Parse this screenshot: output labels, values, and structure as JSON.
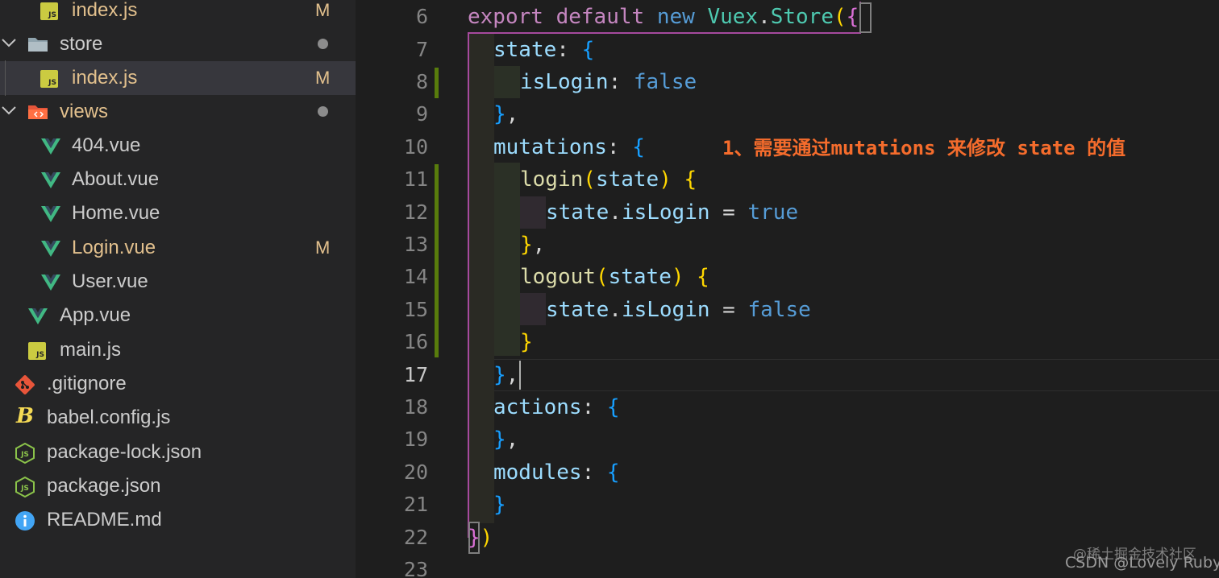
{
  "explorer": {
    "items": [
      {
        "label": "index.js",
        "icon": "js-file-icon",
        "status": "M",
        "modified": true
      },
      {
        "label": "store",
        "icon": "folder-icon",
        "status_dot": true
      },
      {
        "label": "index.js",
        "icon": "js-file-icon",
        "status": "M",
        "modified": true,
        "selected": true
      },
      {
        "label": "views",
        "icon": "views-folder-icon",
        "status_dot": true
      },
      {
        "label": "404.vue",
        "icon": "vue-file-icon"
      },
      {
        "label": "About.vue",
        "icon": "vue-file-icon"
      },
      {
        "label": "Home.vue",
        "icon": "vue-file-icon"
      },
      {
        "label": "Login.vue",
        "icon": "vue-file-icon",
        "status": "M",
        "modified": true
      },
      {
        "label": "User.vue",
        "icon": "vue-file-icon"
      },
      {
        "label": "App.vue",
        "icon": "vue-file-icon"
      },
      {
        "label": "main.js",
        "icon": "js-file-icon"
      },
      {
        "label": ".gitignore",
        "icon": "git-icon"
      },
      {
        "label": "babel.config.js",
        "icon": "babel-icon"
      },
      {
        "label": "package-lock.json",
        "icon": "nodejs-icon"
      },
      {
        "label": "package.json",
        "icon": "nodejs-icon"
      },
      {
        "label": "README.md",
        "icon": "info-icon"
      }
    ]
  },
  "editor": {
    "line_numbers": [
      "6",
      "7",
      "8",
      "9",
      "10",
      "11",
      "12",
      "13",
      "14",
      "15",
      "16",
      "17",
      "18",
      "19",
      "20",
      "21",
      "22",
      "23"
    ],
    "active_line": "17",
    "tokens": {
      "export": "export",
      "default": "default",
      "new": "new",
      "vuex": "Vuex",
      "dot": ".",
      "store": "Store",
      "open_paren": "(",
      "open_brace": "{",
      "state_key": "state",
      "colon": ":",
      "islogin_key": "isLogin",
      "false": "false",
      "close_brace_comma": "},",
      "mutations_key": "mutations",
      "login_fn": "login",
      "state_param": "state",
      "close_paren": ")",
      "state_obj": "state",
      "islogin_prop": "isLogin",
      "equals": "=",
      "true": "true",
      "logout_fn": "logout",
      "close_brace": "}",
      "comma": ",",
      "actions_key": "actions",
      "modules_key": "modules",
      "close_all": "})"
    }
  },
  "annotation": "1、需要通过mutations 来修改 state 的值",
  "watermark": {
    "line1": "@稀土掘金技术社区",
    "line2": "CSDN @Lovely Ruby"
  },
  "colors": {
    "keyword": "#c586c0",
    "type": "#4ec9b0",
    "constant": "#569cd6",
    "property": "#9cdcfe",
    "function": "#dcdcaa",
    "annotation": "#f56c2c",
    "modified": "#e2c08d"
  }
}
